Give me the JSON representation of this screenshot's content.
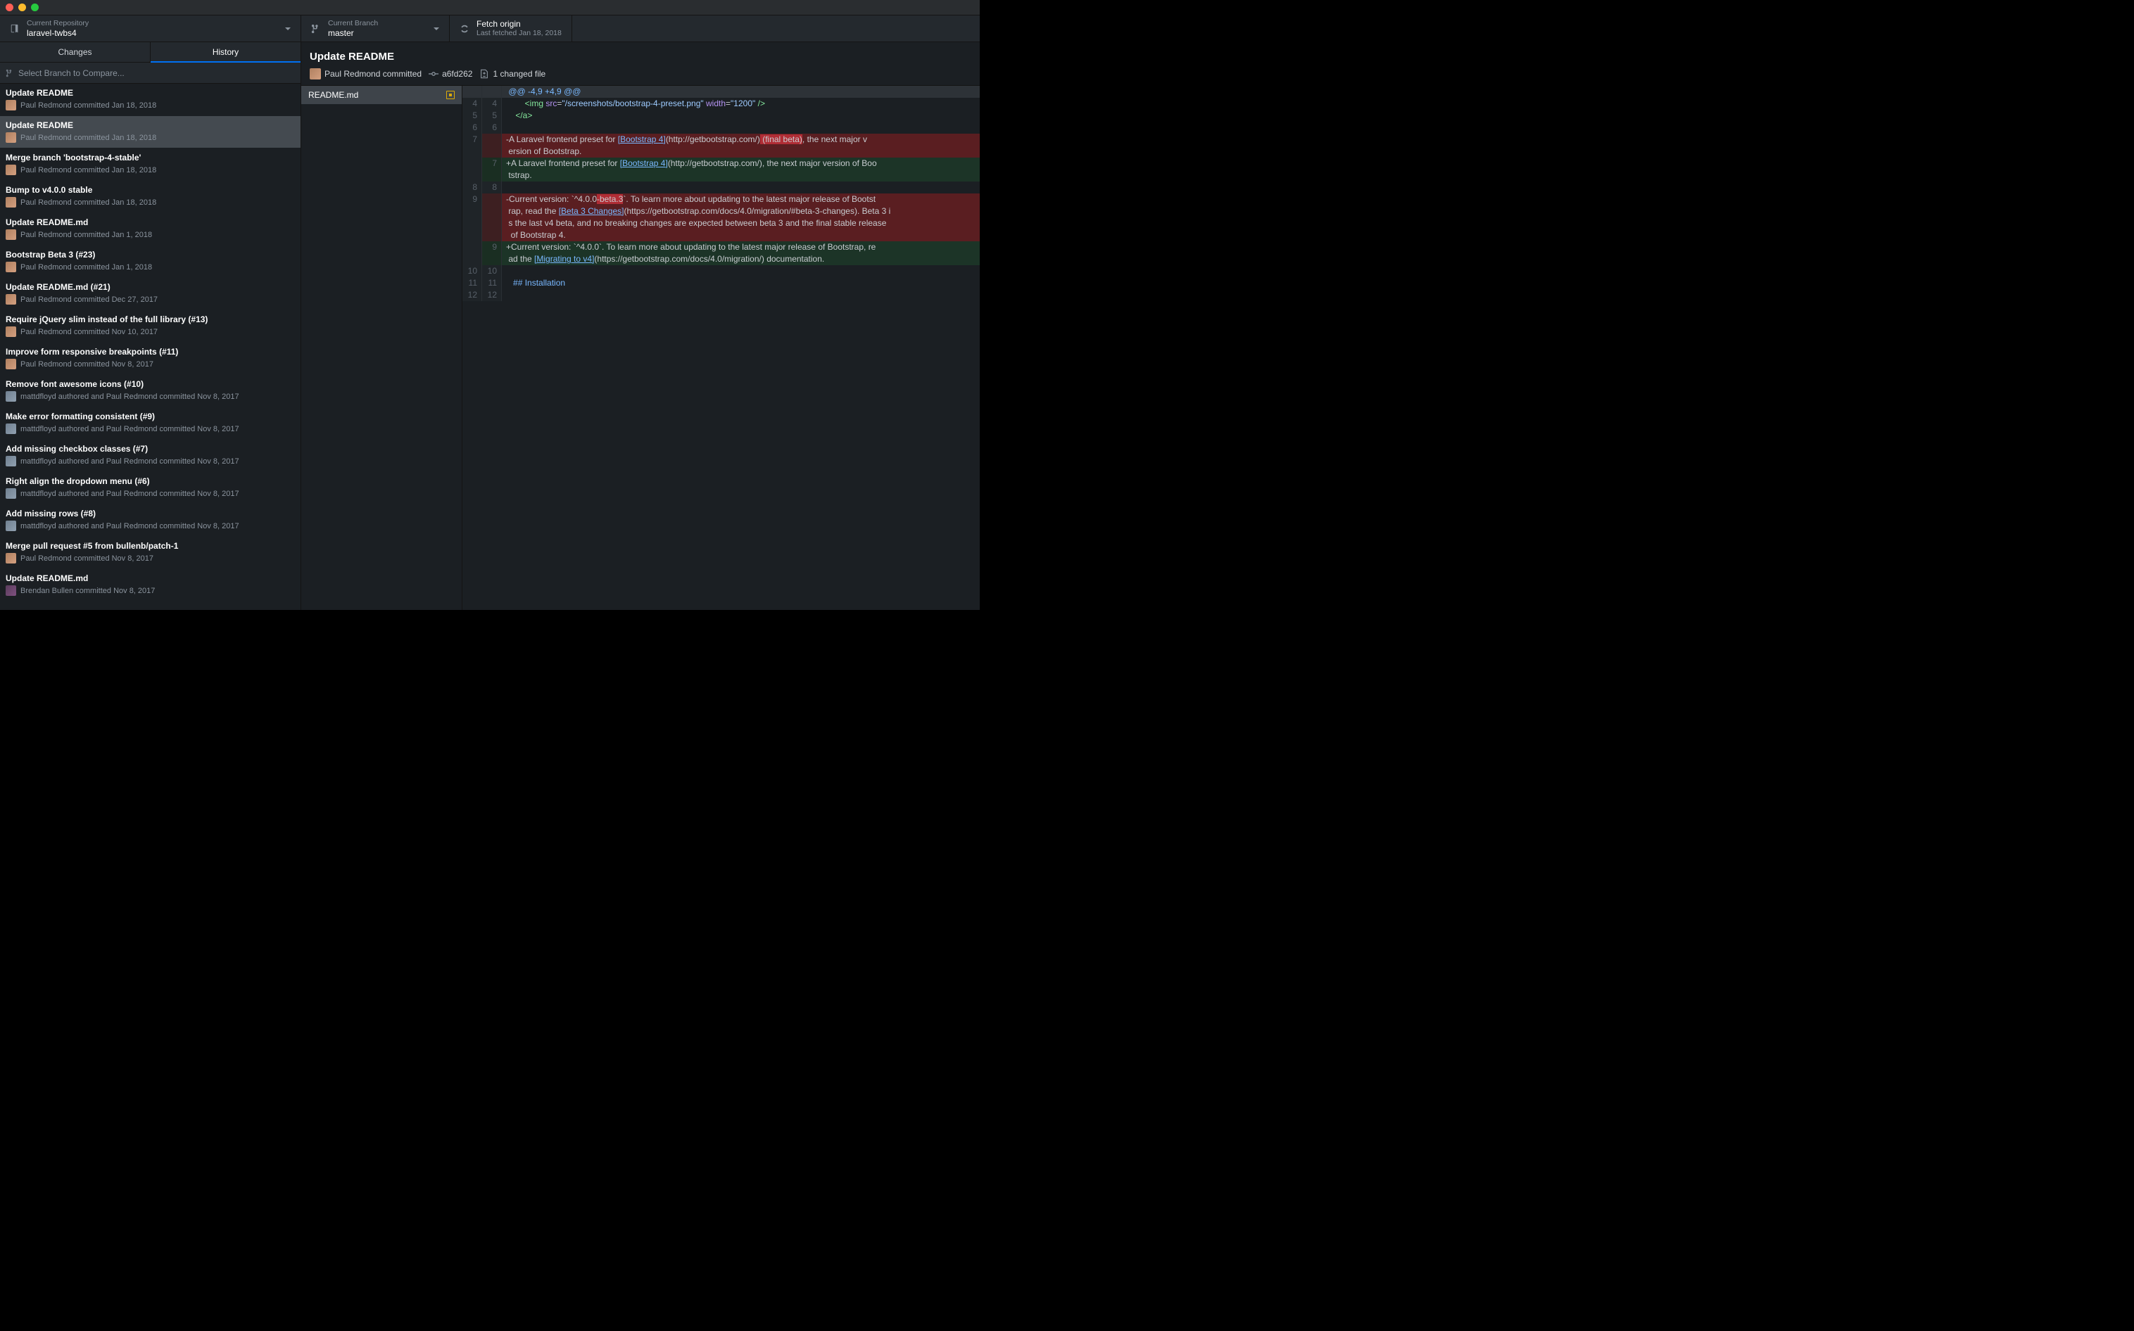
{
  "toolbar": {
    "repo_label": "Current Repository",
    "repo_value": "laravel-twbs4",
    "branch_label": "Current Branch",
    "branch_value": "master",
    "fetch_label": "Fetch origin",
    "fetch_sub": "Last fetched Jan 18, 2018"
  },
  "tabs": {
    "changes": "Changes",
    "history": "History"
  },
  "select_branch_placeholder": "Select Branch to Compare...",
  "commits": [
    {
      "title": "Update README",
      "meta": "Paul Redmond committed Jan 18, 2018",
      "avatar": "a1"
    },
    {
      "title": "Update README",
      "meta": "Paul Redmond committed Jan 18, 2018",
      "avatar": "a1",
      "selected": true
    },
    {
      "title": "Merge branch 'bootstrap-4-stable'",
      "meta": "Paul Redmond committed Jan 18, 2018",
      "avatar": "a1"
    },
    {
      "title": "Bump to v4.0.0 stable",
      "meta": "Paul Redmond committed Jan 18, 2018",
      "avatar": "a1"
    },
    {
      "title": "Update README.md",
      "meta": "Paul Redmond committed Jan 1, 2018",
      "avatar": "a1"
    },
    {
      "title": "Bootstrap Beta 3 (#23)",
      "meta": "Paul Redmond committed Jan 1, 2018",
      "avatar": "a1"
    },
    {
      "title": "Update README.md (#21)",
      "meta": "Paul Redmond committed Dec 27, 2017",
      "avatar": "a1"
    },
    {
      "title": "Require jQuery slim instead of the full library (#13)",
      "meta": "Paul Redmond committed Nov 10, 2017",
      "avatar": "a1"
    },
    {
      "title": "Improve form responsive breakpoints (#11)",
      "meta": "Paul Redmond committed Nov 8, 2017",
      "avatar": "a1"
    },
    {
      "title": "Remove font awesome icons (#10)",
      "meta": "mattdfloyd authored and Paul Redmond committed Nov 8, 2017",
      "avatar": "a2"
    },
    {
      "title": "Make error formatting consistent (#9)",
      "meta": "mattdfloyd authored and Paul Redmond committed Nov 8, 2017",
      "avatar": "a2"
    },
    {
      "title": "Add missing checkbox classes (#7)",
      "meta": "mattdfloyd authored and Paul Redmond committed Nov 8, 2017",
      "avatar": "a2"
    },
    {
      "title": "Right align the dropdown menu (#6)",
      "meta": "mattdfloyd authored and Paul Redmond committed Nov 8, 2017",
      "avatar": "a2"
    },
    {
      "title": "Add missing rows (#8)",
      "meta": "mattdfloyd authored and Paul Redmond committed Nov 8, 2017",
      "avatar": "a2"
    },
    {
      "title": "Merge pull request #5 from bullenb/patch-1",
      "meta": "Paul Redmond committed Nov 8, 2017",
      "avatar": "a1"
    },
    {
      "title": "Update README.md",
      "meta": "Brendan Bullen committed Nov 8, 2017",
      "avatar": "a3"
    }
  ],
  "commit_header": {
    "title": "Update README",
    "author": "Paul Redmond committed",
    "sha": "a6fd262",
    "files": "1 changed file"
  },
  "file": {
    "name": "README.md"
  },
  "diff": {
    "hunk": "@@ -4,9 +4,9 @@",
    "lines": [
      {
        "l": "4",
        "r": "4",
        "t": "ctx",
        "html": "        <span class='tok-tag'>&lt;img</span> <span class='tok-attr'>src</span>=<span class='tok-str'>\"/screenshots/bootstrap-4-preset.png\"</span> <span class='tok-attr'>width</span>=<span class='tok-str'>\"1200\"</span> <span class='tok-tag'>/&gt;</span>"
      },
      {
        "l": "5",
        "r": "5",
        "t": "ctx",
        "html": "    <span class='tok-tag'>&lt;/a&gt;</span>"
      },
      {
        "l": "6",
        "r": "6",
        "t": "ctx",
        "html": ""
      },
      {
        "l": "7",
        "r": "",
        "t": "del",
        "html": "-A Laravel frontend preset for <span class='tok-link'>[Bootstrap 4]</span>(http://getbootstrap.com/)<span class='tok-hl-del'> (final beta)</span>, the next major v"
      },
      {
        "l": "",
        "r": "",
        "t": "del",
        "html": " ersion of Bootstrap."
      },
      {
        "l": "",
        "r": "7",
        "t": "add",
        "html": "+A Laravel frontend preset for <span class='tok-link'>[Bootstrap 4]</span>(http://getbootstrap.com/), the next major version of Boo"
      },
      {
        "l": "",
        "r": "",
        "t": "add",
        "html": " tstrap."
      },
      {
        "l": "8",
        "r": "8",
        "t": "ctx",
        "html": ""
      },
      {
        "l": "9",
        "r": "",
        "t": "del",
        "html": "-Current version: `^4.0.0<span class='tok-hl-del'>-beta.3</span>`. To learn more about updating to the latest major release of Bootst"
      },
      {
        "l": "",
        "r": "",
        "t": "del",
        "html": " rap, read the <span class='tok-link'>[Beta 3 Changes]</span>(https://getbootstrap.com/docs/4.0/migration/#beta-3-changes). Beta 3 i"
      },
      {
        "l": "",
        "r": "",
        "t": "del",
        "html": " s the last v4 beta, and no breaking changes are expected between beta 3 and the final stable release"
      },
      {
        "l": "",
        "r": "",
        "t": "del",
        "html": "  of Bootstrap 4."
      },
      {
        "l": "",
        "r": "9",
        "t": "add",
        "html": "+Current version: `^4.0.0`. To learn more about updating to the latest major release of Bootstrap, re"
      },
      {
        "l": "",
        "r": "",
        "t": "add",
        "html": " ad the <span class='tok-link'>[Migrating to v4]</span>(https://getbootstrap.com/docs/4.0/migration/) documentation."
      },
      {
        "l": "10",
        "r": "10",
        "t": "ctx",
        "html": ""
      },
      {
        "l": "11",
        "r": "11",
        "t": "ctx",
        "html": "   <span class='tok-hd'>## Installation</span>"
      },
      {
        "l": "12",
        "r": "12",
        "t": "ctx",
        "html": ""
      }
    ]
  }
}
